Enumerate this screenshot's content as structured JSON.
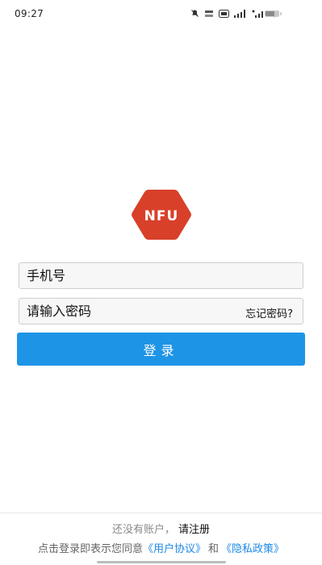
{
  "status_bar": {
    "time": "09:27",
    "icons": [
      "mute-icon",
      "network-speed-icon",
      "hd-icon",
      "signal-icon-1",
      "signal-icon-2",
      "wifi-icon",
      "battery-icon"
    ],
    "battery_level": 0.7
  },
  "logo": {
    "text": "NFU",
    "color": "#d8402a"
  },
  "form": {
    "phone_placeholder": "手机号",
    "password_placeholder": "请输入密码",
    "forgot_password": "忘记密码?",
    "login_button": "登录",
    "accent_color": "#1e94e6"
  },
  "footer": {
    "register_prompt": "还没有账户，",
    "register_link": "请注册",
    "agreement_prefix": "点击登录即表示您同意",
    "user_agreement": "《用户协议》",
    "and": "和",
    "privacy_policy": "《隐私政策》",
    "link_color": "#1e88e5"
  }
}
